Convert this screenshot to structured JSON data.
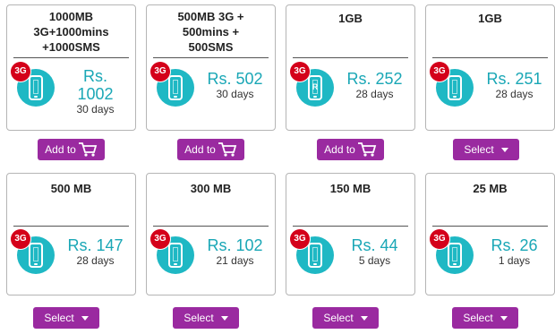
{
  "cards": [
    {
      "title": "1000MB\n3G+1000mins\n+1000SMS",
      "badge": "3G",
      "price_line1": "Rs.",
      "price_line2": "1002",
      "days": "30 days",
      "icon": "mobile-phone-icon",
      "button": {
        "label": "Add to",
        "type": "add-to-cart",
        "icon": "cart-icon"
      }
    },
    {
      "title": "500MB 3G +\n500mins +\n500SMS",
      "badge": "3G",
      "price": "Rs. 502",
      "days": "30 days",
      "icon": "mobile-phone-icon",
      "button": {
        "label": "Add to",
        "type": "add-to-cart",
        "icon": "cart-icon"
      }
    },
    {
      "title": "1GB",
      "badge": "3G",
      "price": "Rs. 252",
      "days": "28 days",
      "icon": "mobile-phone-r-icon",
      "phone_glyph": "R",
      "button": {
        "label": "Add to",
        "type": "add-to-cart",
        "icon": "cart-icon"
      }
    },
    {
      "title": "1GB",
      "badge": "3G",
      "price": "Rs. 251",
      "days": "28 days",
      "icon": "mobile-phone-icon",
      "button": {
        "label": "Select",
        "type": "select"
      }
    },
    {
      "title": "500 MB",
      "badge": "3G",
      "price": "Rs. 147",
      "days": "28 days",
      "icon": "mobile-phone-icon",
      "button": {
        "label": "Select",
        "type": "select"
      }
    },
    {
      "title": "300 MB",
      "badge": "3G",
      "price": "Rs. 102",
      "days": "21 days",
      "icon": "mobile-phone-icon",
      "button": {
        "label": "Select",
        "type": "select"
      }
    },
    {
      "title": "150 MB",
      "badge": "3G",
      "price": "Rs. 44",
      "days": "5 days",
      "icon": "mobile-phone-icon",
      "button": {
        "label": "Select",
        "type": "select"
      }
    },
    {
      "title": "25 MB",
      "badge": "3G",
      "price": "Rs. 26",
      "days": "1 days",
      "icon": "mobile-phone-icon",
      "button": {
        "label": "Select",
        "type": "select"
      }
    }
  ],
  "colors": {
    "price": "#1aa7b6",
    "button": "#9a2aa0",
    "badge": "#d4001a",
    "circle": "#1fb8c4"
  }
}
